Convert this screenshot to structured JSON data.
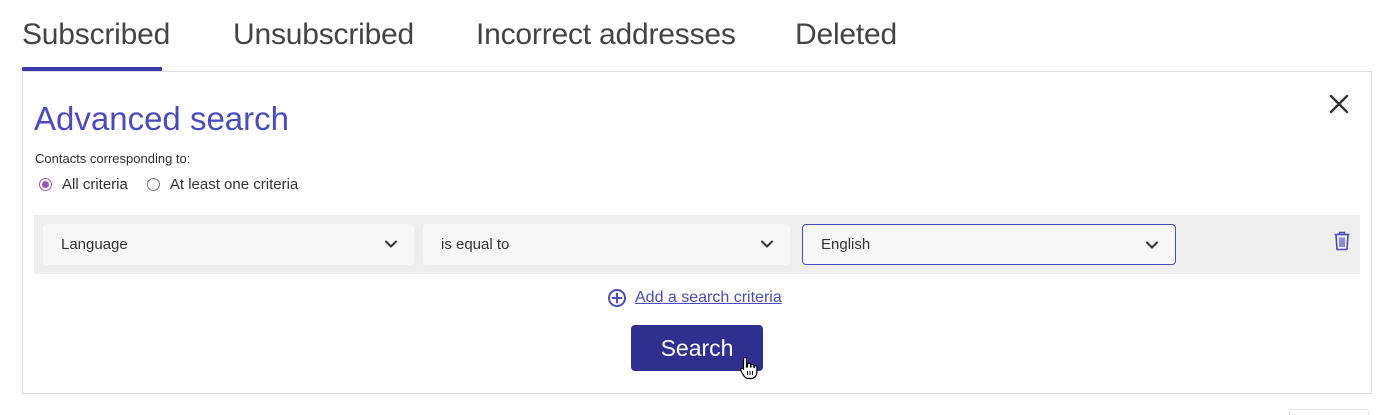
{
  "tabs": [
    {
      "label": "Subscribed",
      "active": true
    },
    {
      "label": "Unsubscribed",
      "active": false
    },
    {
      "label": "Incorrect addresses",
      "active": false
    },
    {
      "label": "Deleted",
      "active": false
    }
  ],
  "panel": {
    "title": "Advanced search",
    "criteria_label": "Contacts corresponding to:",
    "radio_options": [
      {
        "label": "All criteria",
        "checked": true
      },
      {
        "label": "At least one criteria",
        "checked": false
      }
    ],
    "criteria": [
      {
        "field": "Language",
        "operator": "is equal to",
        "value": "English"
      }
    ],
    "add_criteria_label": "Add a search criteria",
    "search_button_label": "Search"
  },
  "icons": {
    "close": "close-icon",
    "chevron": "chevron-down-icon",
    "trash": "trash-icon",
    "add": "plus-circle-icon",
    "cursor": "hand-pointer-cursor-icon"
  },
  "colors": {
    "accent": "#4b4bc0",
    "button": "#2f2f8f",
    "radio": "#9b59b6",
    "row_bg": "#eeeeee",
    "select_bg": "#f7f7f7"
  }
}
